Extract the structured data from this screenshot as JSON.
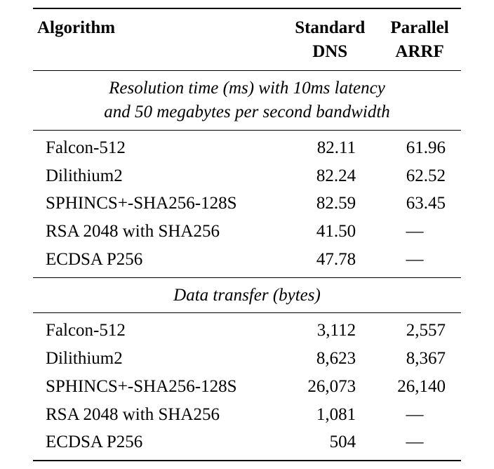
{
  "chart_data": {
    "type": "table",
    "headers": {
      "algorithm": "Algorithm",
      "standard_dns_l1": "Standard",
      "standard_dns_l2": "DNS",
      "parallel_arrf_l1": "Parallel",
      "parallel_arrf_l2": "ARRF"
    },
    "sections": [
      {
        "title_l1": "Resolution time (ms) with 10ms latency",
        "title_l2": "and 50 megabytes per second bandwidth",
        "rows": [
          {
            "algorithm": "Falcon-512",
            "standard_dns": "82.11",
            "parallel_arrf": "61.96"
          },
          {
            "algorithm": "Dilithium2",
            "standard_dns": "82.24",
            "parallel_arrf": "62.52"
          },
          {
            "algorithm": "SPHINCS+-SHA256-128S",
            "standard_dns": "82.59",
            "parallel_arrf": "63.45"
          },
          {
            "algorithm": "RSA 2048 with SHA256",
            "standard_dns": "41.50",
            "parallel_arrf": "—"
          },
          {
            "algorithm": "ECDSA P256",
            "standard_dns": "47.78",
            "parallel_arrf": "—"
          }
        ]
      },
      {
        "title_l1": "Data transfer (bytes)",
        "title_l2": "",
        "rows": [
          {
            "algorithm": "Falcon-512",
            "standard_dns": "3,112",
            "parallel_arrf": "2,557"
          },
          {
            "algorithm": "Dilithium2",
            "standard_dns": "8,623",
            "parallel_arrf": "8,367"
          },
          {
            "algorithm": "SPHINCS+-SHA256-128S",
            "standard_dns": "26,073",
            "parallel_arrf": "26,140"
          },
          {
            "algorithm": "RSA 2048 with SHA256",
            "standard_dns": "1,081",
            "parallel_arrf": "—"
          },
          {
            "algorithm": "ECDSA P256",
            "standard_dns": "504",
            "parallel_arrf": "—"
          }
        ]
      }
    ]
  }
}
